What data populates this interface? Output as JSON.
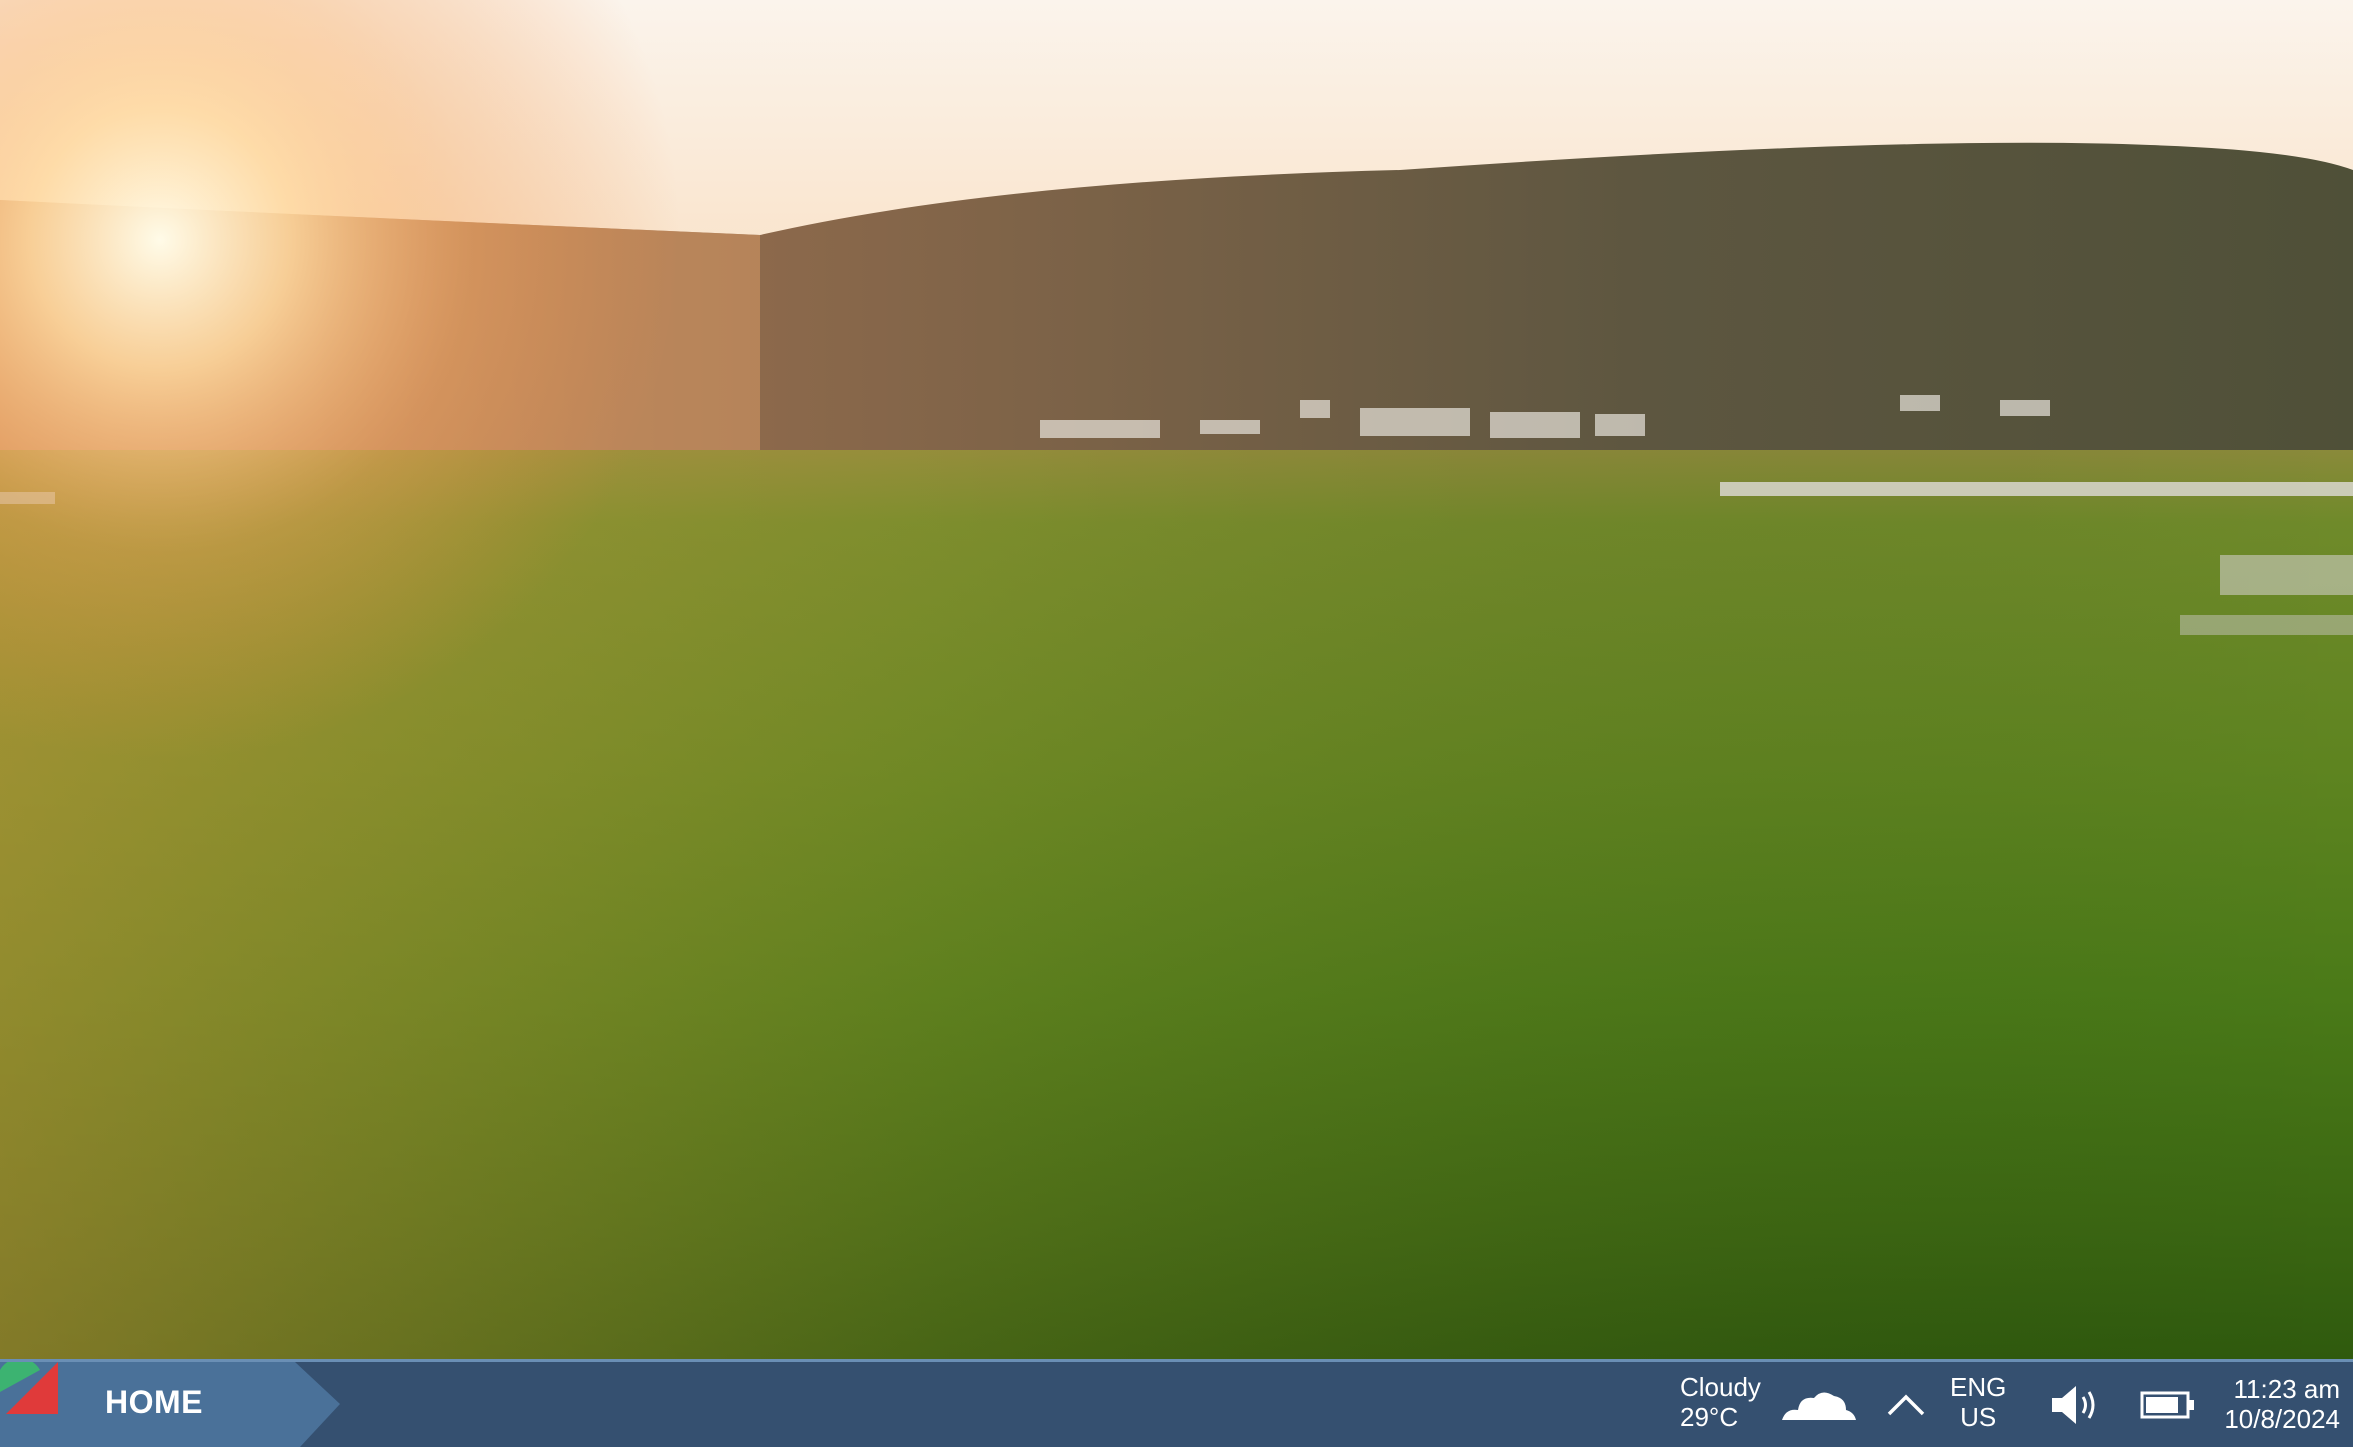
{
  "desktop": {
    "wallpaper": "sunset-grass-field-wallpaper"
  },
  "taskbar": {
    "start_label": "HOME",
    "weather": {
      "condition": "Cloudy",
      "temperature": "29°C",
      "icon": "cloud-icon"
    },
    "tray_overflow_icon": "chevron-up-icon",
    "language": {
      "line1": "ENG",
      "line2": "US"
    },
    "volume_icon": "speaker-icon",
    "battery_icon": "battery-icon",
    "clock": {
      "time": "11:23 am",
      "date": "10/8/2024"
    },
    "colors": {
      "taskbar_bg": "#355070",
      "start_bg": "#4a7199",
      "logo_green": "#3cb371",
      "logo_red": "#e03a3a"
    }
  }
}
